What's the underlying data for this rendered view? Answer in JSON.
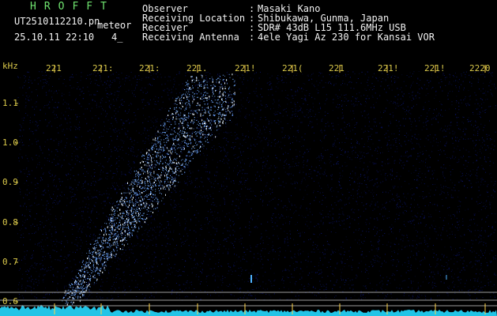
{
  "header": {
    "brand": "HROFFT",
    "filename": "UT2510112210.pn",
    "mode": "meteor",
    "datetime": "25.10.11 22:10",
    "page": "4_",
    "rows": [
      {
        "label": "Observer",
        "colon": ":",
        "value": "Masaki Kano"
      },
      {
        "label": "Receiving Location",
        "colon": ":",
        "value": "Shibukawa, Gunma, Japan"
      },
      {
        "label": "Receiver",
        "colon": ":",
        "value": "SDR# 43dB L15 111.6MHz USB"
      },
      {
        "label": "Receiving Antenna",
        "colon": ":",
        "value": "4ele Yagi Az 230 for Kansai VOR"
      }
    ]
  },
  "spectrogram": {
    "unit_label": "kHz",
    "time_ticks": [
      "221",
      "221:",
      "221:",
      "221.",
      "221!",
      "221(",
      "221",
      "221!",
      "221!",
      "2220"
    ],
    "freq_ticks": [
      "1.1",
      "1.0",
      "0.9",
      "0.8",
      "0.7",
      "0.6"
    ],
    "colors": {
      "background": "#000000",
      "noise": "#0e1a8c",
      "signal": "#6fa8ff",
      "signal_bright": "#e6f2ff",
      "axis_text": "#d9c84a",
      "spectrum": "#26d9ff",
      "tick": "#ffd54a",
      "divider": "#b9b9b9",
      "header_green": "#6fe36f"
    }
  }
}
